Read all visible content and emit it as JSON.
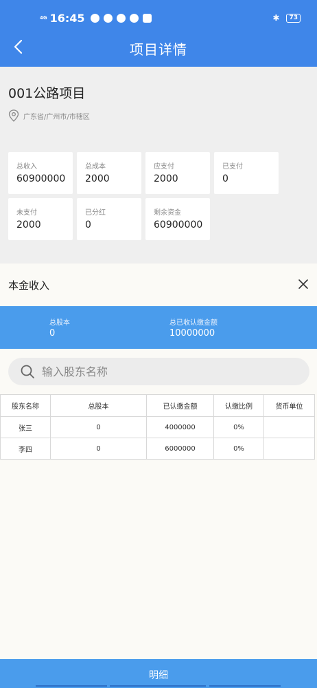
{
  "status": {
    "network": "4G",
    "time": "16:45",
    "battery": "73"
  },
  "header": {
    "title": "项目详情"
  },
  "project": {
    "name": "001公路项目",
    "location": "广东省/广州市/市辖区"
  },
  "stats": [
    {
      "label": "总收入",
      "value": "60900000"
    },
    {
      "label": "总成本",
      "value": "2000"
    },
    {
      "label": "应支付",
      "value": "2000"
    },
    {
      "label": "已支付",
      "value": "0"
    },
    {
      "label": "未支付",
      "value": "2000"
    },
    {
      "label": "已分红",
      "value": "0"
    },
    {
      "label": "剩余资金",
      "value": "60900000"
    }
  ],
  "sheet": {
    "title": "本金收入",
    "summary": {
      "total_shares_label": "总股本",
      "total_shares_value": "0",
      "total_paid_label": "总已收认缴金额",
      "total_paid_value": "10000000"
    },
    "search": {
      "placeholder": "输入股东名称"
    },
    "table": {
      "headers": [
        "股东名称",
        "总股本",
        "已认缴金额",
        "认缴比例",
        "货币单位"
      ],
      "rows": [
        [
          "张三",
          "0",
          "4000000",
          "0%",
          ""
        ],
        [
          "李四",
          "0",
          "6000000",
          "0%",
          ""
        ]
      ]
    }
  },
  "bottom": {
    "button_label": "明细"
  },
  "colors": {
    "header_blue": "#3f86e9",
    "summary_blue": "#4a9cec"
  }
}
